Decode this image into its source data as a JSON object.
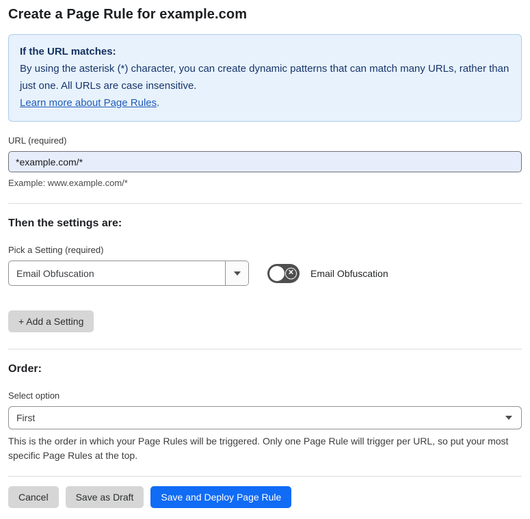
{
  "page": {
    "title": "Create a Page Rule for example.com"
  },
  "info_box": {
    "heading": "If the URL matches:",
    "body": "By using the asterisk (*) character, you can create dynamic patterns that can match many URLs, rather than just one. All URLs are case insensitive.",
    "link_label": "Learn more about Page Rules",
    "link_suffix": "."
  },
  "url_field": {
    "label": "URL (required)",
    "value": "*example.com/*",
    "helper": "Example: www.example.com/*"
  },
  "settings_section": {
    "heading": "Then the settings are:",
    "pick_label": "Pick a Setting (required)",
    "selected_setting": "Email Obfuscation",
    "toggle_label": "Email Obfuscation",
    "toggle_state": "off",
    "toggle_glyph": "✕",
    "add_button_label": "+ Add a Setting"
  },
  "order_section": {
    "heading": "Order:",
    "select_label": "Select option",
    "selected_option": "First",
    "helper": "This is the order in which your Page Rules will be triggered. Only one Page Rule will trigger per URL, so put your most specific Page Rules at the top."
  },
  "footer": {
    "cancel_label": "Cancel",
    "save_draft_label": "Save as Draft",
    "save_deploy_label": "Save and Deploy Page Rule"
  },
  "colors": {
    "info_bg": "#e8f2fc",
    "info_border": "#abcdec",
    "info_text": "#16356b",
    "link_blue": "#1f5cb8",
    "input_bg": "#e7edfb",
    "primary_button_blue": "#106bf5",
    "gray_button": "#d6d6d6",
    "toggle_off_gray": "#4f4f4f"
  }
}
